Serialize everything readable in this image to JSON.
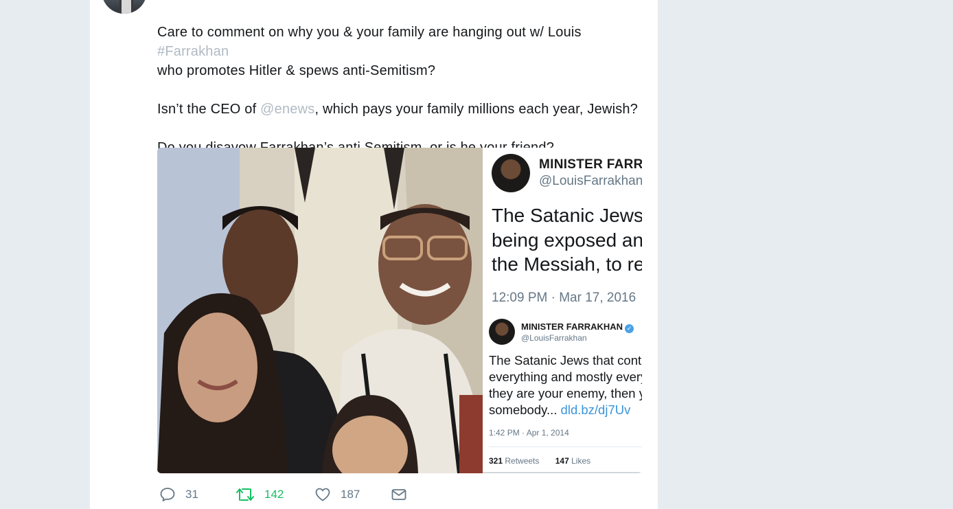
{
  "tweet": {
    "text_line1a": "Care to comment on why you & your family are hanging out w/ Louis ",
    "hashtag": "#Farrakhan",
    "text_line1b": "who promotes Hitler & spews anti-Semitism?",
    "text_line2a": "Isn’t the CEO of ",
    "mention": "@enews",
    "text_line2b": ", which pays your family millions each year, Jewish?",
    "text_line3": "Do you disavow Farrakhan’s anti Semitism, or is he your friend?"
  },
  "media": {
    "screenshot": {
      "big_name": "MINISTER FARRA",
      "big_handle": "@LouisFarrakhan",
      "big_text_lines": [
        "The Satanic Jews a",
        "being exposed and",
        "the Messiah, to rev"
      ],
      "big_time": "12:09 PM · Mar 17, 2016",
      "small_name": "MINISTER FARRAKHAN",
      "verified_glyph": "✓",
      "small_handle": "@LouisFarrakhan",
      "small_text_lines": [
        "The Satanic Jews that contro",
        "everything and mostly everyl",
        "they are your enemy, then yo",
        "somebody... "
      ],
      "small_link": "dld.bz/dj7Uv",
      "small_time": "1:42 PM · Apr 1, 2014",
      "retweets_count": "321",
      "retweets_label": " Retweets",
      "likes_count": "147",
      "likes_label": " Likes"
    }
  },
  "actions": {
    "reply_icon": "reply-icon",
    "reply_count": "31",
    "retweet_icon": "retweet-icon",
    "retweet_count": "142",
    "like_icon": "heart-icon",
    "like_count": "187",
    "dm_icon": "envelope-icon"
  },
  "colors": {
    "background": "#e6ecf0",
    "card": "#ffffff",
    "text": "#14171a",
    "muted_link": "#b1bac3",
    "retweet_green": "#17bf63",
    "link_blue": "#3b94d9"
  }
}
